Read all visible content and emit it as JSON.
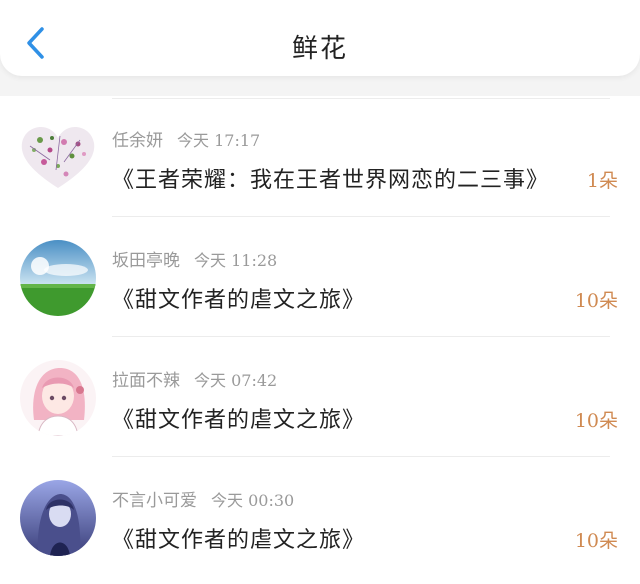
{
  "header": {
    "title": "鲜花",
    "back_icon": "chevron-left-icon",
    "accent": "#2f90e6"
  },
  "items": [
    {
      "user": "任余妍",
      "time": "今天 17:17",
      "book": "《王者荣耀：我在王者世界网恋的二三事》",
      "count": "1朵"
    },
    {
      "user": "坂田亭晚",
      "time": "今天 11:28",
      "book": "《甜文作者的虐文之旅》",
      "count": "10朵"
    },
    {
      "user": "拉面不辣",
      "time": "今天 07:42",
      "book": "《甜文作者的虐文之旅》",
      "count": "10朵"
    },
    {
      "user": "不言小可爱",
      "time": "今天 00:30",
      "book": "《甜文作者的虐文之旅》",
      "count": "10朵"
    }
  ],
  "colors": {
    "count": "#d08a52",
    "meta": "#9a9a9a"
  }
}
